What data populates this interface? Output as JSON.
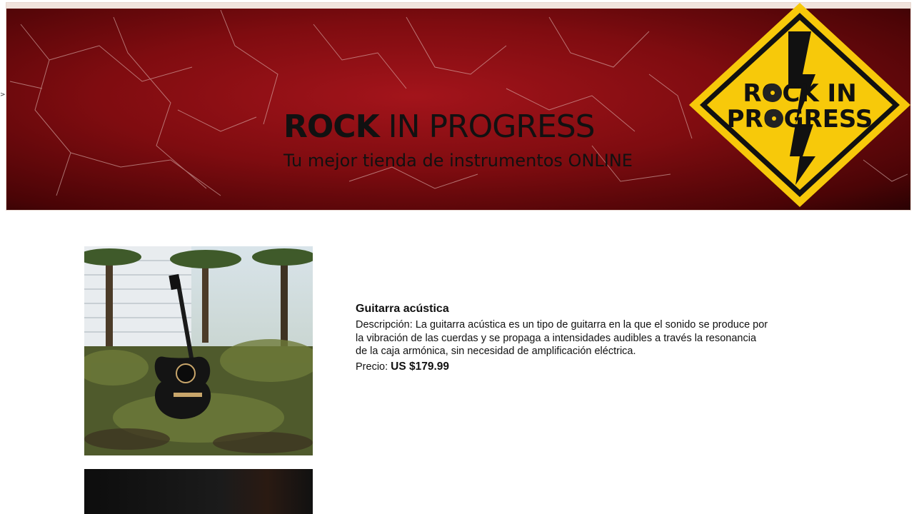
{
  "header": {
    "title_bold": "ROCK",
    "title_rest": "IN PROGRESS",
    "subtitle": "Tu mejor tienda de instrumentos ONLINE",
    "logo_text_line1": "ROCK IN",
    "logo_text_line2": "PROGRESS"
  },
  "colors": {
    "banner_red": "#8c0f14",
    "logo_yellow": "#f7c90a",
    "logo_black": "#111111"
  },
  "products": [
    {
      "name": "Guitarra acústica",
      "description_label": "Descripción:",
      "description": "La guitarra acústica es un tipo de guitarra en la que el sonido se produce por la vibración de las cuerdas y se propaga a intensidades audibles a través la resonancia de la caja armónica, sin necesidad de amplificación eléctrica.",
      "price_label": "Precio:",
      "price": "US $179.99"
    }
  ],
  "misc": {
    "stray_mark": ">"
  }
}
